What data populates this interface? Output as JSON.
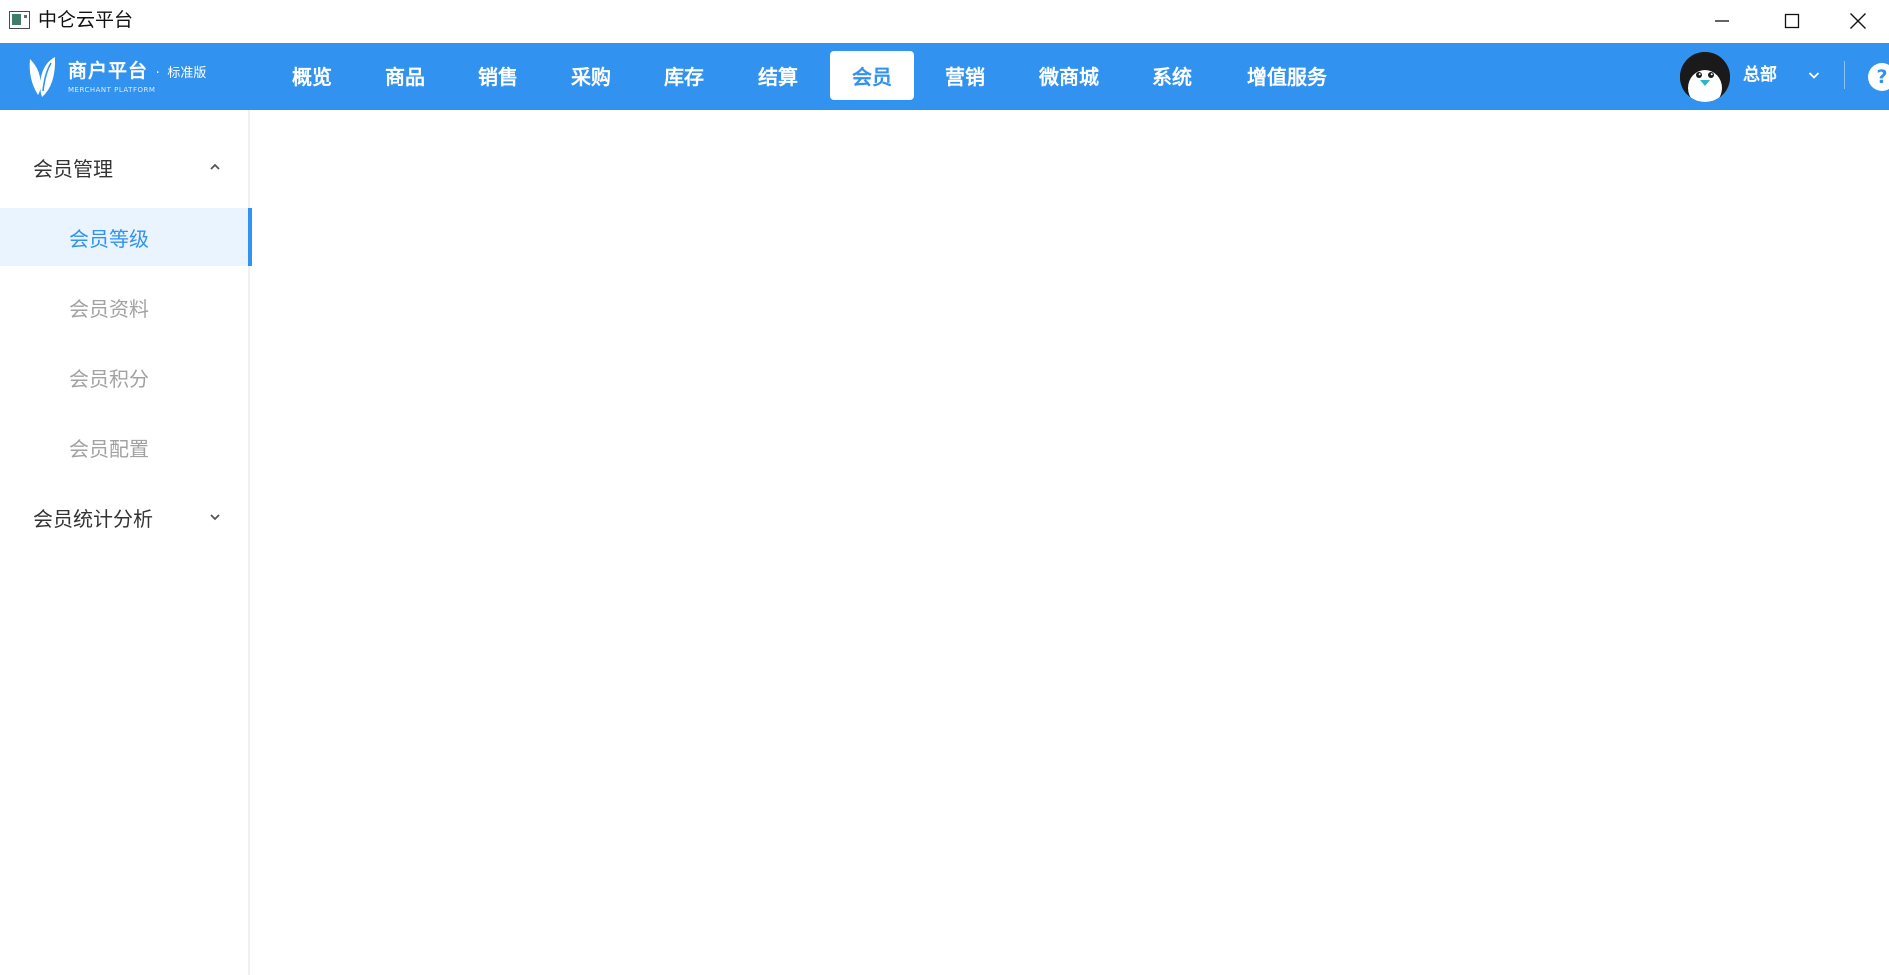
{
  "window": {
    "title": "中仑云平台"
  },
  "brand": {
    "name": "商户平台",
    "separator": "·",
    "edition": "标准版",
    "subtitle": "MERCHANT PLATFORM"
  },
  "nav": {
    "items": [
      {
        "label": "概览"
      },
      {
        "label": "商品"
      },
      {
        "label": "销售"
      },
      {
        "label": "采购"
      },
      {
        "label": "库存"
      },
      {
        "label": "结算"
      },
      {
        "label": "会员",
        "active": true
      },
      {
        "label": "营销"
      },
      {
        "label": "微商城"
      },
      {
        "label": "系统"
      },
      {
        "label": "增值服务"
      }
    ],
    "user_name": "总部",
    "help": "?"
  },
  "sidebar": {
    "groups": [
      {
        "label": "会员管理",
        "expanded": true,
        "items": [
          {
            "label": "会员等级",
            "active": true
          },
          {
            "label": "会员资料"
          },
          {
            "label": "会员积分"
          },
          {
            "label": "会员配置"
          }
        ]
      },
      {
        "label": "会员统计分析",
        "expanded": false
      }
    ]
  },
  "colors": {
    "primary": "#3192f0",
    "active_bg": "#e9f4ff",
    "text_dark": "#333333",
    "text_muted": "#a2a2a2"
  }
}
